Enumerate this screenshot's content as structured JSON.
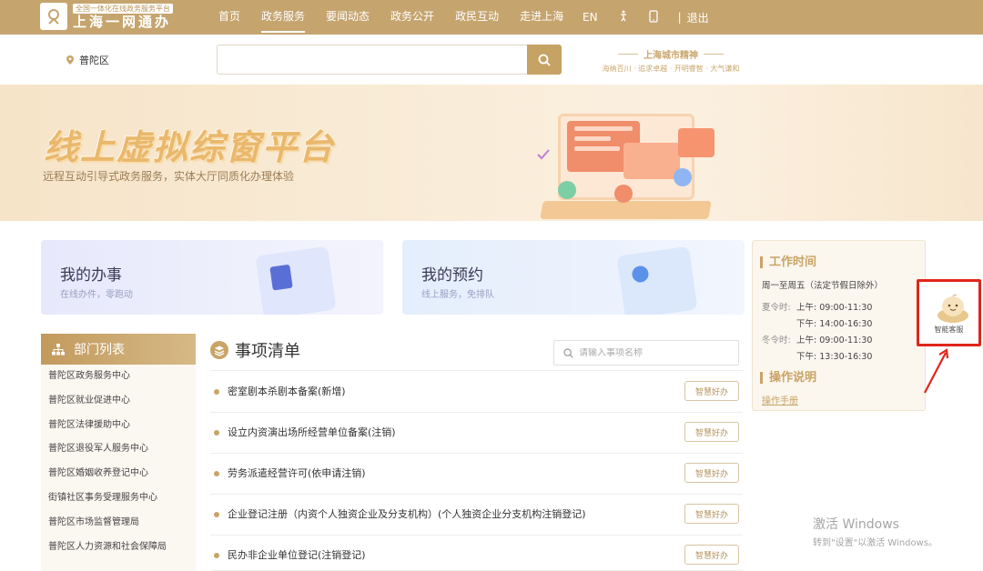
{
  "header": {
    "logo_tag": "全国一体化在线政务服务平台",
    "logo_name": "上海一网通办",
    "nav": [
      "首页",
      "政务服务",
      "要闻动态",
      "政务公开",
      "政民互动",
      "走进上海"
    ],
    "active_nav": "政务服务",
    "lang": "EN",
    "logout": "退出"
  },
  "search_row": {
    "location": "普陀区",
    "search_placeholder": "",
    "spirit_title": "上海城市精神",
    "spirit_sub": "海纳百川 · 追求卓越 · 开明睿智 · 大气谦和"
  },
  "banner": {
    "title": "线上虚拟综窗平台",
    "subtitle": "远程互动引导式政务服务，实体大厅同质化办理体验"
  },
  "cards": [
    {
      "title": "我的办事",
      "subtitle": "在线办件，零跑动"
    },
    {
      "title": "我的预约",
      "subtitle": "线上服务，免排队"
    }
  ],
  "worktime": {
    "title": "工作时间",
    "days": "周一至周五（法定节假日除外）",
    "summer_label": "夏令时:",
    "winter_label": "冬令时:",
    "am": "上午:",
    "pm": "下午:",
    "summer_am": "09:00-11:30",
    "summer_pm": "14:00-16:30",
    "winter_am": "09:00-11:30",
    "winter_pm": "13:30-16:30",
    "ops_title": "操作说明",
    "manual_link": "操作手册"
  },
  "bot": {
    "label": "智能客服"
  },
  "departments": {
    "title": "部门列表",
    "items": [
      "普陀区政务服务中心",
      "普陀区就业促进中心",
      "普陀区法律援助中心",
      "普陀区退役军人服务中心",
      "普陀区婚姻收养登记中心",
      "街镇社区事务受理服务中心",
      "普陀区市场监督管理局",
      "普陀区人力资源和社会保障局"
    ]
  },
  "items_list": {
    "title": "事项清单",
    "search_placeholder": "请输入事项名称",
    "button_label": "智慧好办",
    "rows": [
      "密室剧本杀剧本备案(新增)",
      "设立内资演出场所经营单位备案(注销)",
      "劳务派遣经营许可(依申请注销)",
      "企业登记注册（内资个人独资企业及分支机构）(个人独资企业分支机构注销登记)",
      "民办非企业单位登记(注销登记)"
    ]
  },
  "watermark": {
    "line1": "激活 Windows",
    "line2": "转到\"设置\"以激活 Windows。"
  },
  "colors": {
    "brand_gold": "#c5a46e",
    "highlight_red": "#e0251b"
  }
}
